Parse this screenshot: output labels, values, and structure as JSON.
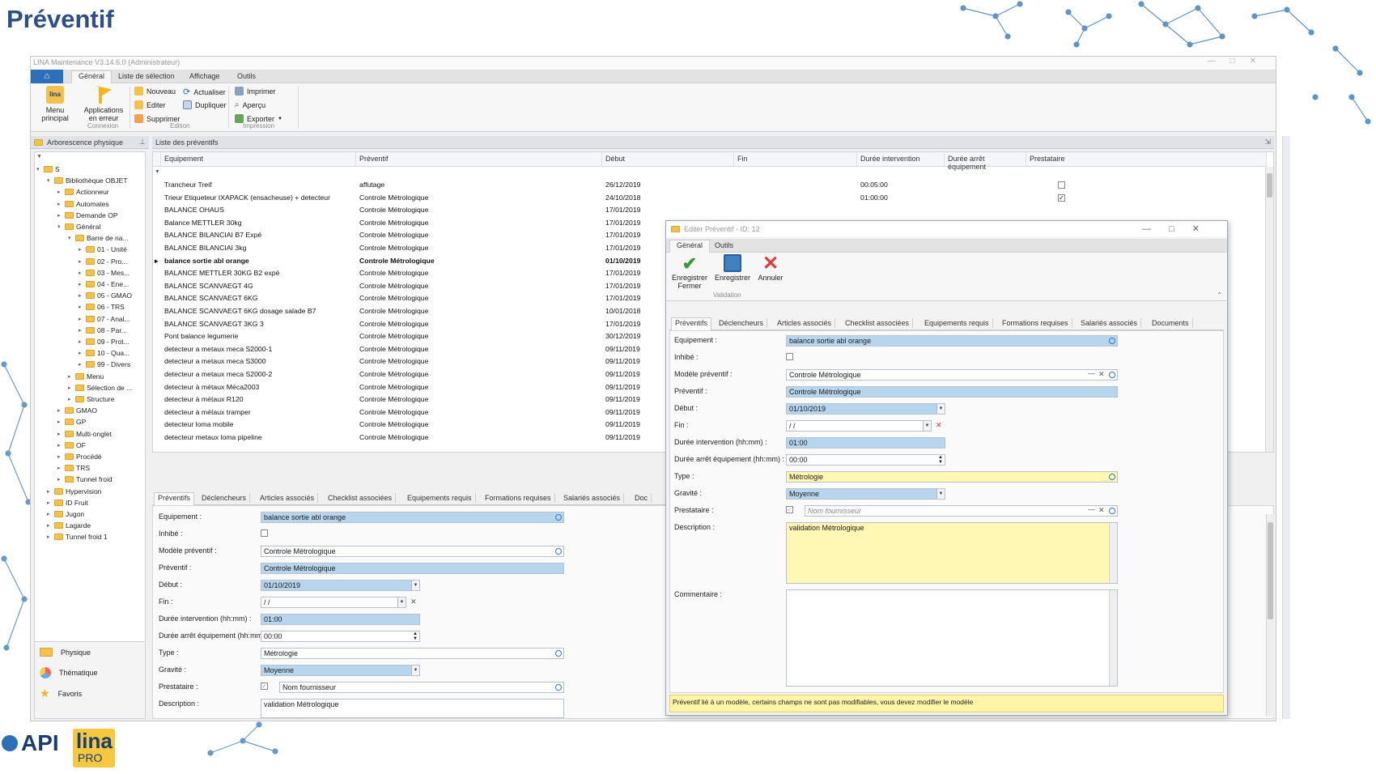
{
  "slide_title": "Préventif",
  "window": {
    "title": "LINA Maintenance V3.14.6.0 (Administrateur)"
  },
  "ribbon": {
    "tabs": [
      "Général",
      "Liste de sélection",
      "Affichage",
      "Outils"
    ],
    "menu_principal": "Menu principal",
    "applications_erreur": "Applications en erreur",
    "connexion_group": "Connexion",
    "nouveau": "Nouveau",
    "editer": "Editer",
    "supprimer": "Supprimer",
    "actualiser": "Actualiser",
    "dupliquer": "Dupliquer",
    "edition_group": "Edition",
    "imprimer": "Imprimer",
    "apercu": "Aperçu",
    "exporter": "Exporter",
    "impression_group": "Impression"
  },
  "tree": {
    "header": "Arborescence physique",
    "items": [
      {
        "label": "S",
        "level": 0,
        "open": true
      },
      {
        "label": "Bibliothèque OBJET",
        "level": 1,
        "open": true
      },
      {
        "label": "Actionneur",
        "level": 2
      },
      {
        "label": "Automates",
        "level": 2
      },
      {
        "label": "Demande OP",
        "level": 2
      },
      {
        "label": "Général",
        "level": 2,
        "open": true
      },
      {
        "label": "Barre de na...",
        "level": 3,
        "open": true
      },
      {
        "label": "01 - Unité",
        "level": 4
      },
      {
        "label": "02 - Pro...",
        "level": 4
      },
      {
        "label": "03 - Mes...",
        "level": 4
      },
      {
        "label": "04 - Ene...",
        "level": 4
      },
      {
        "label": "05 - GMAO",
        "level": 4
      },
      {
        "label": "06 - TRS",
        "level": 4
      },
      {
        "label": "07 - Anal...",
        "level": 4
      },
      {
        "label": "08 - Par...",
        "level": 4
      },
      {
        "label": "09 - Prot...",
        "level": 4
      },
      {
        "label": "10 - Qua...",
        "level": 4
      },
      {
        "label": "99 - Divers",
        "level": 4
      },
      {
        "label": "Menu",
        "level": 3
      },
      {
        "label": "Sélection de ...",
        "level": 3
      },
      {
        "label": "Structure",
        "level": 3
      },
      {
        "label": "GMAO",
        "level": 2
      },
      {
        "label": "GP",
        "level": 2
      },
      {
        "label": "Multi-onglet",
        "level": 2
      },
      {
        "label": "OF",
        "level": 2
      },
      {
        "label": "Procédé",
        "level": 2
      },
      {
        "label": "TRS",
        "level": 2
      },
      {
        "label": "Tunnel froid",
        "level": 2
      },
      {
        "label": "Hypervision",
        "level": 1
      },
      {
        "label": "ID Fruit",
        "level": 1
      },
      {
        "label": "Jugon",
        "level": 1
      },
      {
        "label": "Lagarde",
        "level": 1
      },
      {
        "label": "Tunnel froid 1",
        "level": 1
      }
    ]
  },
  "nav": {
    "physique": "Physique",
    "thematique": "Thématique",
    "favoris": "Favoris"
  },
  "grid": {
    "header": "Liste des préventifs",
    "columns": [
      "Equipement",
      "Préventif",
      "Début",
      "Fin",
      "Durée intervention",
      "Durée arrêt équipement",
      "Prestataire"
    ],
    "rows": [
      [
        "Trancheur Treif",
        "affutage",
        "26/12/2019",
        "",
        "00:05:00",
        "",
        "",
        "unchecked"
      ],
      [
        "Trieur Etiqueteur IXAPACK (ensacheuse) + detecteur",
        "Controle Métrologique",
        "24/10/2018",
        "",
        "01:00:00",
        "",
        "",
        "checked"
      ],
      [
        "BALANCE OHAUS",
        "Controle Métrologique",
        "17/01/2019",
        "",
        "",
        "",
        "",
        ""
      ],
      [
        "Balance METTLER 30kg",
        "Controle Métrologique",
        "17/01/2019",
        "",
        "",
        "",
        "",
        ""
      ],
      [
        "BALANCE BILANCIAI B7 Expé",
        "Controle Métrologique",
        "17/01/2019",
        "",
        "",
        "",
        "",
        ""
      ],
      [
        "BALANCE BILANCIAI 3kg",
        "Controle Métrologique",
        "17/01/2019",
        "",
        "",
        "",
        "",
        ""
      ],
      [
        "balance sortie abl orange",
        "Controle Métrologique",
        "01/10/2019",
        "",
        "",
        "",
        "",
        ""
      ],
      [
        "BALANCE METTLER 30KG B2 expé",
        "Controle Métrologique",
        "17/01/2019",
        "",
        "",
        "",
        "",
        ""
      ],
      [
        "BALANCE SCANVAEGT 4G",
        "Controle Métrologique",
        "17/01/2019",
        "",
        "",
        "",
        "",
        ""
      ],
      [
        "BALANCE SCANVAEGT 6KG",
        "Controle Métrologique",
        "17/01/2019",
        "",
        "",
        "",
        "",
        ""
      ],
      [
        "BALANCE SCANVAEGT 6KG dosage salade B7",
        "Controle Métrologique",
        "10/01/2018",
        "",
        "",
        "",
        "",
        ""
      ],
      [
        "BALANCE SCANVAEGT 3KG 3",
        "Controle Métrologique",
        "17/01/2019",
        "",
        "",
        "",
        "",
        ""
      ],
      [
        "Pont balance legumerie",
        "Controle Métrologique",
        "30/12/2019",
        "",
        "",
        "",
        "",
        ""
      ],
      [
        "detecteur a metaux meca S2000-1",
        "Controle Métrologique",
        "09/11/2019",
        "",
        "",
        "",
        "",
        ""
      ],
      [
        "detecteur a metaux meca S3000",
        "Controle Métrologique",
        "09/11/2019",
        "",
        "",
        "",
        "",
        ""
      ],
      [
        "detecteur a metaux meca S2000-2",
        "Controle Métrologique",
        "09/11/2019",
        "",
        "",
        "",
        "",
        ""
      ],
      [
        "detecteur à métaux Méca2003",
        "Controle Métrologique",
        "09/11/2019",
        "",
        "",
        "",
        "",
        ""
      ],
      [
        "detecteur à métaux R120",
        "Controle Métrologique",
        "09/11/2019",
        "",
        "",
        "",
        "",
        ""
      ],
      [
        "detecteur à métaux tramper",
        "Controle Métrologique",
        "09/11/2019",
        "",
        "",
        "",
        "",
        ""
      ],
      [
        "detecteur loma mobile",
        "Controle Métrologique",
        "09/11/2019",
        "",
        "",
        "",
        "",
        ""
      ],
      [
        "detecteur metaux loma pipeline",
        "Controle Métrologique",
        "09/11/2019",
        "",
        "",
        "",
        "",
        ""
      ]
    ]
  },
  "subtabs": [
    "Préventifs",
    "Déclencheurs",
    "Articles associés",
    "Checklist associées",
    "Equipements requis",
    "Formations requises",
    "Salariés associés",
    "Doc"
  ],
  "form": {
    "labels": {
      "equipement": "Equipement :",
      "inhibe": "Inhibé :",
      "modele": "Modèle préventif :",
      "preventif": "Préventif :",
      "debut": "Début :",
      "fin": "Fin :",
      "duree_int": "Durée intervention (hh:mm) :",
      "duree_arret": "Durée arrêt équipement (hh:mm) :",
      "type": "Type :",
      "gravite": "Gravité :",
      "prestataire": "Prestataire :",
      "description": "Description :",
      "commentaire": "Commentaire :"
    },
    "values": {
      "equipement": "balance sortie abl orange",
      "modele": "Controle Métrologique",
      "preventif": "Controle Métrologique",
      "debut": "01/10/2019",
      "fin": "  /   /",
      "duree_int": "01:00",
      "duree_arret": "00:00",
      "type": "Métrologie",
      "gravite": "Moyenne",
      "prestataire": "Nom fournisseur",
      "description": "validation Métrologique"
    }
  },
  "dialog": {
    "title": "Editer Préventif - ID: 12",
    "tabs": [
      "Général",
      "Outils"
    ],
    "save_close": "Enregistrer Fermer",
    "save": "Enregistrer",
    "cancel": "Annuler",
    "validation_group": "Validation",
    "subtabs": [
      "Préventifs",
      "Déclencheurs",
      "Articles associés",
      "Checklist associées",
      "Equipements requis",
      "Formations requises",
      "Salariés associés",
      "Documents"
    ],
    "warning": "Préventif lié à un modèle, certains champs ne sont pas modifiables, vous devez modifier le modèle"
  },
  "colors": {
    "accent": "#2b4f86",
    "field_blue": "#b7d6ee",
    "field_yellow": "#fff7b3"
  }
}
